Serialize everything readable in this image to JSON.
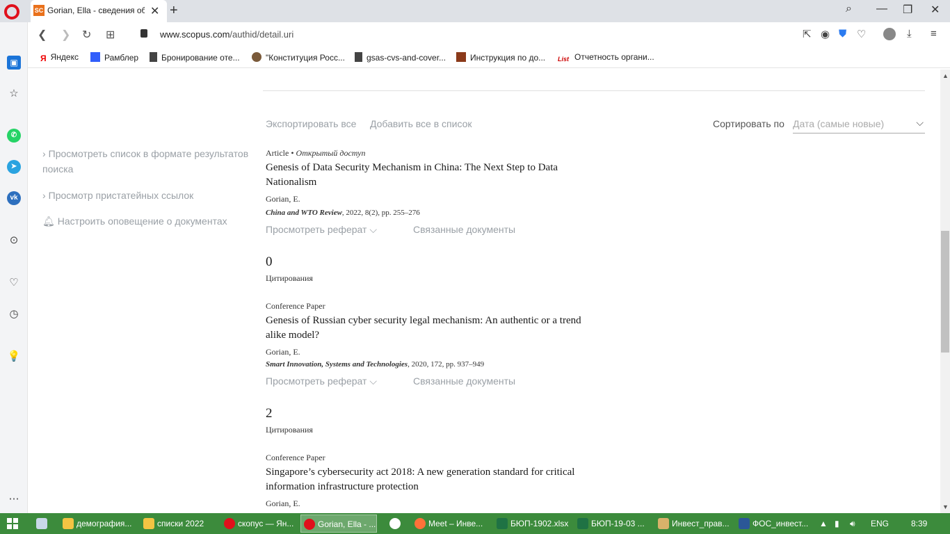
{
  "browser": {
    "tab": {
      "favicon": "SC",
      "title": "Gorian, Ella - сведения об"
    },
    "url_domain": "www.scopus.com",
    "url_path": "/authid/detail.uri",
    "bookmarks": [
      "Яндекс",
      "Рамблер",
      "Бронирование оте...",
      "\"Конституция Росс...",
      "gsas-cvs-and-cover...",
      "Инструкция по до...",
      "Отчетность органи..."
    ]
  },
  "toolbar": {
    "export_all": "Экспортировать все",
    "add_all_to_list": "Добавить все в список",
    "sort_label": "Сортировать по",
    "sort_value": "Дата (самые новые)"
  },
  "side_links": {
    "view_list": "Просмотреть список в формате результатов поиска",
    "view_refs": "Просмотр пристатейных ссылок",
    "set_alert": "Настроить оповещение о документах"
  },
  "documents": [
    {
      "type": "Article",
      "open_access": "Открытый доступ",
      "title": "Genesis of Data Security Mechanism in China: The Next Step to Data Nationalism",
      "author": "Gorian, E.",
      "journal": "China and WTO Review",
      "details": ", 2022, 8(2), pp. 255–276",
      "view_abstract": "Просмотреть реферат",
      "related": "Связанные документы",
      "citations": "0",
      "citations_label": "Цитирования"
    },
    {
      "type": "Conference Paper",
      "title": "Genesis of Russian cyber security legal mechanism: An authentic or a trend alike model?",
      "author": "Gorian, E.",
      "journal": "Smart Innovation, Systems and Technologies",
      "details": ", 2020, 172, pp. 937–949",
      "view_abstract": "Просмотреть реферат",
      "related": "Связанные документы",
      "citations": "2",
      "citations_label": "Цитирования"
    },
    {
      "type": "Conference Paper",
      "title": "Singapore’s cybersecurity act 2018: A new generation standard for critical information infrastructure protection",
      "author": "Gorian, E."
    }
  ],
  "taskbar": {
    "items": [
      "демография...",
      "списки 2022",
      "скопус — Ян...",
      "Gorian, Ella - ...",
      "Meet – Инве...",
      "БЮП-1902.xlsx",
      "БЮП-19-03 ...",
      "Инвест_прав...",
      "ФОС_инвест..."
    ],
    "lang": "ENG",
    "time": "8:39"
  }
}
